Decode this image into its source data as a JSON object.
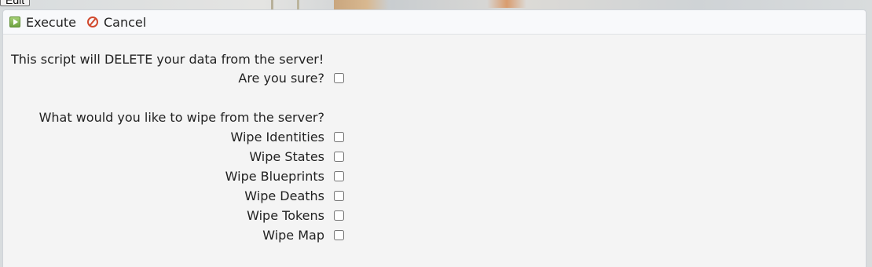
{
  "edit_button": {
    "label": "Edit"
  },
  "toolbar": {
    "execute_label": "Execute",
    "cancel_label": "Cancel"
  },
  "form": {
    "warning": "This script will DELETE your data from the server!",
    "confirm_label": "Are you sure?",
    "confirm_checked": false,
    "question": "What would you like to wipe from the server?",
    "options": [
      {
        "label": "Wipe Identities",
        "checked": false
      },
      {
        "label": "Wipe States",
        "checked": false
      },
      {
        "label": "Wipe Blueprints",
        "checked": false
      },
      {
        "label": "Wipe Deaths",
        "checked": false
      },
      {
        "label": "Wipe Tokens",
        "checked": false
      },
      {
        "label": "Wipe Map",
        "checked": false
      }
    ]
  },
  "colors": {
    "execute_icon": "#6fa341",
    "cancel_icon": "#d14a2e"
  },
  "icons": {
    "execute": "play-icon",
    "cancel": "cancel-icon"
  }
}
